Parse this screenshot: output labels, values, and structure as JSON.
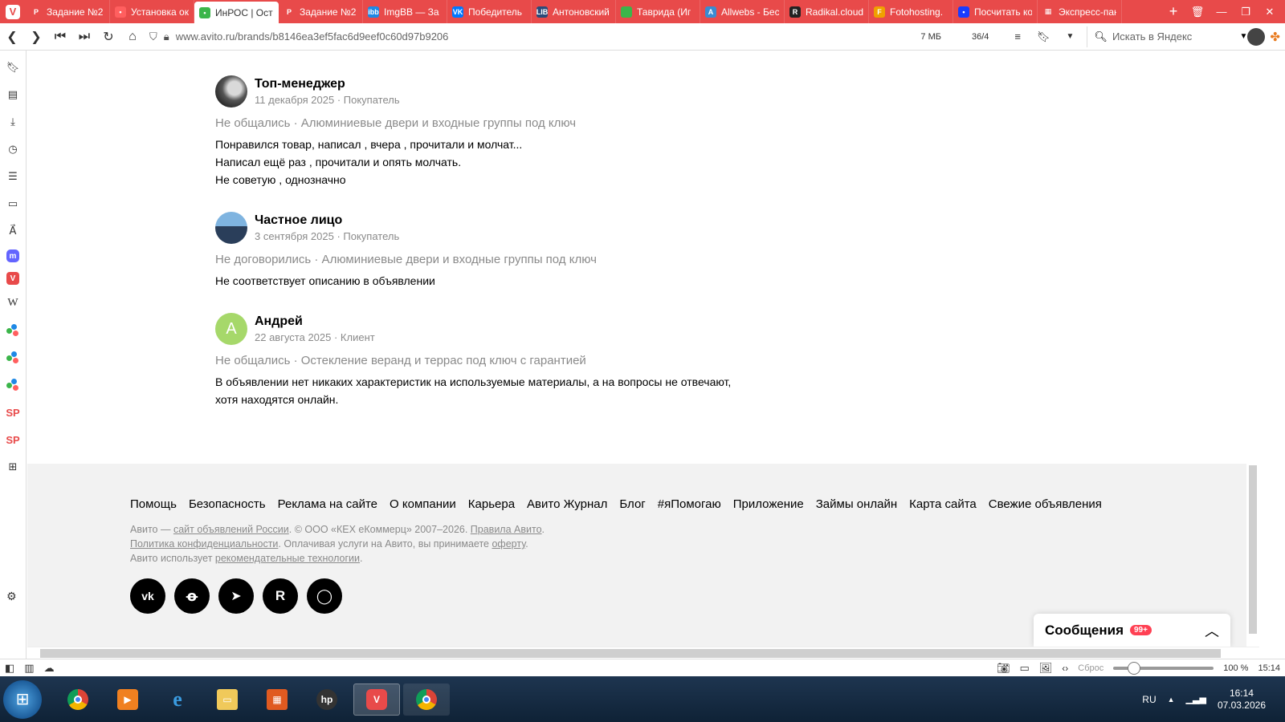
{
  "browser": {
    "tabs": [
      {
        "title": "Задание №2",
        "color": "#e84a4a",
        "glyph": "P"
      },
      {
        "title": "Установка ок",
        "color": "#ff5f5f",
        "glyph": "•"
      },
      {
        "title": "ИнРОС | Ост",
        "color": "#3bb54a",
        "glyph": "•",
        "active": true
      },
      {
        "title": "Задание №2",
        "color": "#e84a4a",
        "glyph": "P"
      },
      {
        "title": "ImgBB — За",
        "color": "#1e88e5",
        "glyph": "ibb"
      },
      {
        "title": "Победитель",
        "color": "#0077ff",
        "glyph": "VK"
      },
      {
        "title": "Антоновский",
        "color": "#2b4b7a",
        "glyph": "LIB"
      },
      {
        "title": "Таврида (Иг",
        "color": "#3bb54a",
        "glyph": ""
      },
      {
        "title": "Allwebs - Бес",
        "color": "#3a8bd0",
        "glyph": "A"
      },
      {
        "title": "Radikal.cloud",
        "color": "#222",
        "glyph": "R"
      },
      {
        "title": "Fotohosting.",
        "color": "#f0a000",
        "glyph": "F"
      },
      {
        "title": "Посчитать ко",
        "color": "#1a3cff",
        "glyph": "•"
      },
      {
        "title": "Экспресс-пан",
        "color": "#e84a4a",
        "glyph": "▦"
      }
    ],
    "url": "www.avito.ru/brands/b8146ea3ef5fac6d9eef0c60d97b9206",
    "memory": "7 МБ",
    "counter": "36/4",
    "search_placeholder": "Искать в Яндекс"
  },
  "reviews": [
    {
      "name": "Топ-менеджер",
      "meta": "11 декабря 2025 · Покупатель",
      "deal": "Не общались · Алюминиевые двери и входные группы под ключ",
      "text": [
        "Понравился товар, написал , вчера , прочитали и молчат...",
        "Написал ещё раз , прочитали и опять молчать.",
        "Не советую , однозначно"
      ]
    },
    {
      "name": "Частное лицо",
      "meta": "3 сентября 2025 · Покупатель",
      "deal": "Не договорились · Алюминиевые двери и входные группы под ключ",
      "text": [
        "Не соответствует описанию в объявлении"
      ]
    },
    {
      "name": "Андрей",
      "initial": "А",
      "meta": "22 августа 2025 · Клиент",
      "deal": "Не общались · Остекление веранд и террас под ключ с гарантией",
      "text": [
        "В объявлении нет никаких характеристик на используемые материалы, а на вопросы не отвечают,",
        "хотя находятся онлайн."
      ]
    }
  ],
  "footer": {
    "links": [
      "Помощь",
      "Безопасность",
      "Реклама на сайте",
      "О компании",
      "Карьера",
      "Авито Журнал",
      "Блог",
      "#яПомогаю",
      "Приложение",
      "Займы онлайн",
      "Карта сайта",
      "Свежие объявления"
    ],
    "legal": {
      "l1_a": "Авито — ",
      "l1_link": "сайт объявлений России",
      "l1_b": ". © ООО «КЕХ еКоммерц» 2007–2026. ",
      "l1_link2": "Правила Авито",
      "l1_c": ".",
      "l2_link": "Политика конфиденциальности",
      "l2_a": ". Оплачивая услуги на Авито, вы принимаете ",
      "l2_link2": "оферту",
      "l2_b": ".",
      "l3_a": "Авито использует ",
      "l3_link": "рекомендательные технологии",
      "l3_b": "."
    },
    "socials": [
      "VK",
      "OK",
      "TG",
      "R",
      "MAX"
    ]
  },
  "messages": {
    "label": "Сообщения",
    "badge": "99+"
  },
  "statusbar": {
    "reset": "Сброс",
    "zoom": "100 %",
    "time": "15:14"
  },
  "taskbar": {
    "lang": "RU",
    "time": "16:14",
    "date": "07.03.2026"
  }
}
